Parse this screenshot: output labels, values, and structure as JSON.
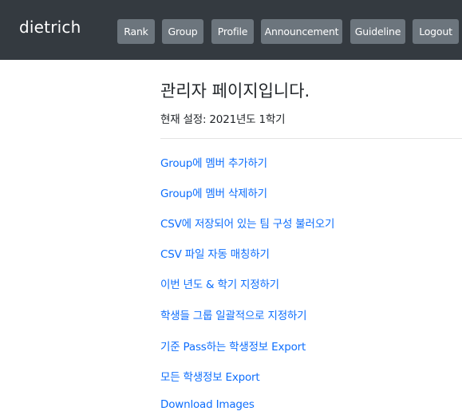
{
  "navbar": {
    "brand": "dietrich",
    "buttons": [
      {
        "label": "Rank"
      },
      {
        "label": "Group"
      },
      {
        "label": "Profile"
      },
      {
        "label": "Announcement"
      },
      {
        "label": "Guideline"
      },
      {
        "label": "Logout"
      }
    ]
  },
  "main": {
    "title": "관리자 페이지입니다.",
    "current_setting": "현재 설정: 2021년도 1학기",
    "links": [
      "Group에 멤버 추가하기",
      "Group에 멤버 삭제하기",
      "CSV에 저장되어 있는 팀 구성 불러오기",
      "CSV 파일 자동 매칭하기",
      "이번 년도 & 학기 지정하기",
      "학생들 그룹 일괄적으로 지정하기",
      "기준 Pass하는 학생정보 Export",
      "모든 학생정보 Export",
      "Download Images"
    ]
  },
  "colors": {
    "navbar_bg": "#343a40",
    "button_bg": "#6c757d",
    "link": "#0d6efd"
  }
}
